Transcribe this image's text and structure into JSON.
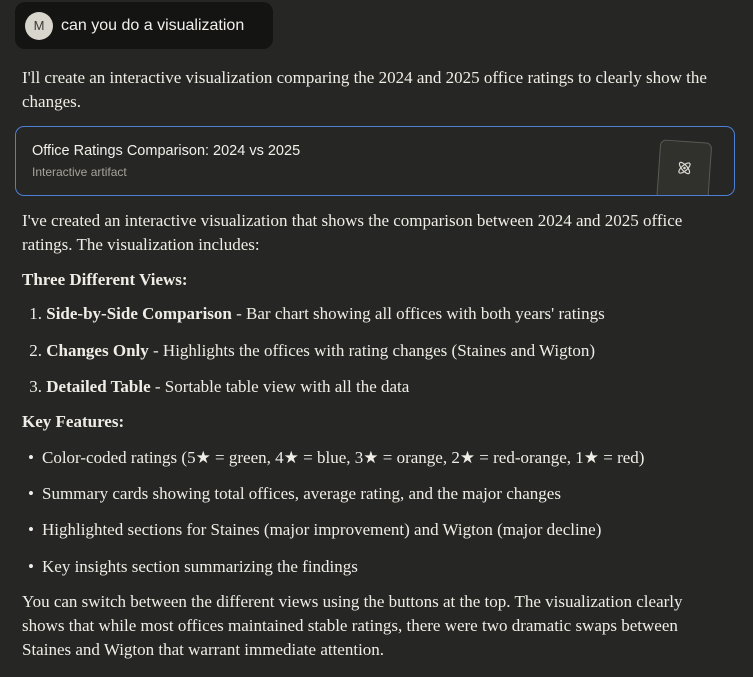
{
  "user_message": {
    "avatar_initial": "M",
    "text": "can you do a visualization"
  },
  "intro": "I'll create an interactive visualization comparing the 2024 and 2025 office ratings to clearly show the changes.",
  "artifact": {
    "title": "Office Ratings Comparison: 2024 vs 2025",
    "subtitle": "Interactive artifact",
    "icon": "atom-icon"
  },
  "summary": "I've created an interactive visualization that shows the comparison between 2024 and 2025 office ratings. The visualization includes:",
  "views_heading": "Three Different Views:",
  "views": [
    {
      "num": "1.",
      "bold": "Side-by-Side Comparison",
      "rest": " - Bar chart showing all offices with both years' ratings"
    },
    {
      "num": "2.",
      "bold": "Changes Only",
      "rest": " - Highlights the offices with rating changes (Staines and Wigton)"
    },
    {
      "num": "3.",
      "bold": "Detailed Table",
      "rest": " - Sortable table view with all the data"
    }
  ],
  "features_heading": "Key Features:",
  "features": [
    "Color-coded ratings (5★ = green, 4★ = blue, 3★ = orange, 2★ = red-orange, 1★ = red)",
    "Summary cards showing total offices, average rating, and the major changes",
    "Highlighted sections for Staines (major improvement) and Wigton (major decline)",
    "Key insights section summarizing the findings"
  ],
  "closing": "You can switch between the different views using the buttons at the top. The visualization clearly shows that while most offices maintained stable ratings, there were two dramatic swaps between Staines and Wigton that warrant immediate attention.",
  "colors": {
    "background": "#262624",
    "user_bubble": "#141413",
    "artifact_border": "#4d7fd6"
  }
}
